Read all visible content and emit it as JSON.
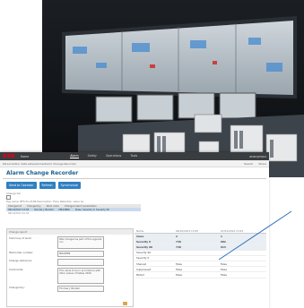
{
  "app": {
    "brand": "ABB",
    "section": "Home",
    "nav": [
      "Alarm",
      "Safety",
      "Operations",
      "Tools"
    ],
    "active_nav": "Alarm",
    "user": "anonymous",
    "breadcrumb": "Personal/Our data sets/alarms/Alarm Change Recorder",
    "crumb_actions": [
      "Search",
      "Share"
    ],
    "page_title": "Alarm Change Recorder",
    "buttons": [
      "Send to Operator",
      "Refresh",
      "Synchronize"
    ],
    "change_log_label": "Change list",
    "tag_line": "Tag name: BFS-TI+2166    Description: Flare Retention value 1a",
    "summary_headers": [
      "Changed at",
      "Changed by",
      "Work order",
      "Changed alarm parameters"
    ],
    "summary_row": [
      "06/10/2013 13:05",
      "Rondal J. Bardell",
      "MR24886",
      "Class, Severity 0, Severity 90"
    ],
    "summary_row2": "06/10/2013 10:03",
    "form": {
      "header": "Change report",
      "fields": [
        {
          "label": "Summary of work:",
          "value": "Was changed as part of the upgrade run"
        },
        {
          "label": "Workorder number:",
          "value": "MR24886"
        },
        {
          "label": "Change reference:",
          "value": ""
        },
        {
          "label": "Comments:",
          "value": "This value to be in accordance with other values of tables 2016"
        },
        {
          "label": "Changed by:",
          "value": "Thomas J. Bardell"
        }
      ]
    },
    "grid": {
      "headers": [
        "Name",
        "06/10/2013 13:05",
        "07/01/2012 13:03"
      ],
      "rows": [
        {
          "name": "Class",
          "a": "2",
          "b": "1",
          "hl": true
        },
        {
          "name": "Severity 0",
          "a": "730",
          "b": "982",
          "hl": true
        },
        {
          "name": "Severity 90",
          "a": "730",
          "b": "913",
          "hl": true
        },
        {
          "name": "Severity 90",
          "a": "",
          "b": "",
          "hl": false
        },
        {
          "name": "Severity 0",
          "a": "",
          "b": "",
          "hl": false
        },
        {
          "name": "Shelved",
          "a": "False",
          "b": "False",
          "hl": false
        },
        {
          "name": "Suppressed",
          "a": "False",
          "b": "False",
          "hl": false
        },
        {
          "name": "Muted",
          "a": "False",
          "b": "False",
          "hl": false
        }
      ]
    }
  },
  "colors": {
    "brand": "#e2001a",
    "accent": "#2f7fc1",
    "title": "#1e5f8e",
    "topbar": "#3a3d40",
    "pointer_line": "#2a6fb8"
  }
}
